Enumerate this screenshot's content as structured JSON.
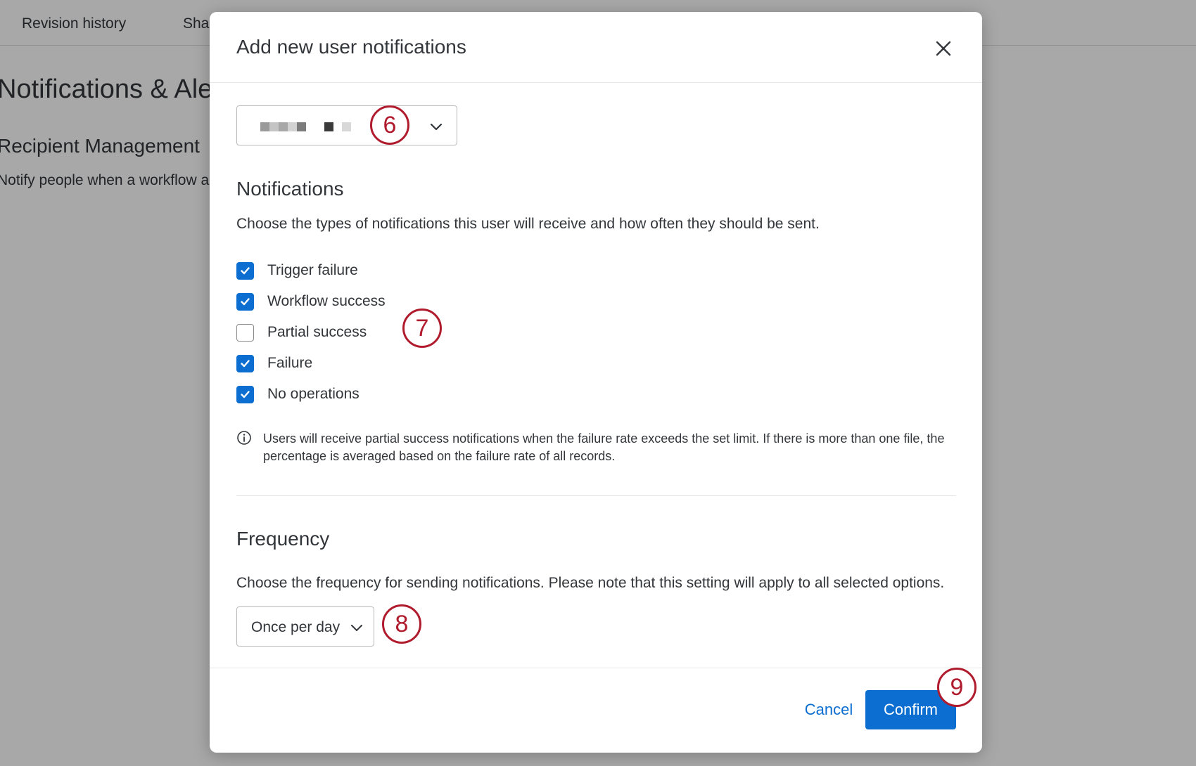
{
  "background": {
    "tabs": [
      "Revision history",
      "Sha"
    ],
    "title": "Notifications & Aler",
    "subtitle": "Recipient Management",
    "description": "Notify people when a workflow a"
  },
  "modal": {
    "title": "Add new user notifications",
    "close_icon": "close-icon",
    "user_select": {
      "value_redacted": true,
      "icon": "chevron-down-icon"
    },
    "notifications": {
      "title": "Notifications",
      "description": "Choose the types of notifications this user will receive and how often they should be sent.",
      "options": [
        {
          "label": "Trigger failure",
          "checked": true
        },
        {
          "label": "Workflow success",
          "checked": true
        },
        {
          "label": "Partial success",
          "checked": false
        },
        {
          "label": "Failure",
          "checked": true
        },
        {
          "label": "No operations",
          "checked": true
        }
      ],
      "info": "Users will receive partial success notifications when the failure rate exceeds the set limit. If there is more than one file, the percentage is averaged based on the failure rate of all records."
    },
    "frequency": {
      "title": "Frequency",
      "description": "Choose the frequency for sending notifications. Please note that this setting will apply to all selected options.",
      "selected": "Once per day"
    },
    "footer": {
      "cancel_label": "Cancel",
      "confirm_label": "Confirm"
    }
  },
  "callouts": [
    "6",
    "7",
    "8",
    "9"
  ],
  "colors": {
    "accent": "#0b6ed0",
    "callout": "#b01c2e"
  }
}
